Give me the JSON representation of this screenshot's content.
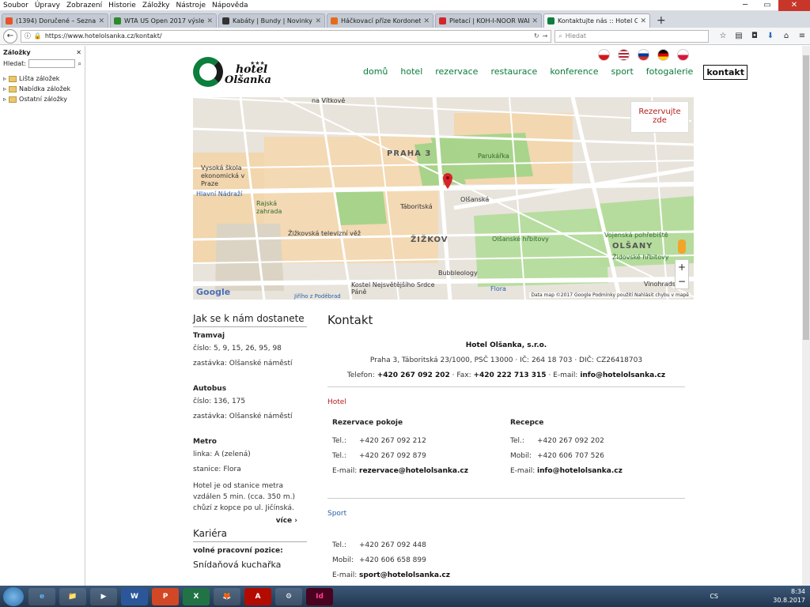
{
  "menubar": [
    "Soubor",
    "Úpravy",
    "Zobrazení",
    "Historie",
    "Záložky",
    "Nástroje",
    "Nápověda"
  ],
  "tabs": [
    {
      "label": "(1394) Doručené – Seznam E",
      "color": "#e8532b"
    },
    {
      "label": "WTA US Open 2017 výsledky",
      "color": "#2b8a2b"
    },
    {
      "label": "Kabáty | Bundy | Novinky | O",
      "color": "#333333"
    },
    {
      "label": "Háčkovací příze Kordonet 30",
      "color": "#e56c1b"
    },
    {
      "label": "Pletací | KOH-I-NOOR WALD",
      "color": "#d3262c"
    },
    {
      "label": "Kontaktujte nás :: Hotel Olšan",
      "color": "#0c7f3c",
      "active": true
    }
  ],
  "nav": {
    "url": "https://www.hotelolsanka.cz/kontakt/",
    "search_placeholder": "Hledat"
  },
  "sidebar": {
    "title": "Záložky",
    "search_label": "Hledat:",
    "items": [
      "Lišta záložek",
      "Nabídka záložek",
      "Ostatní záložky"
    ]
  },
  "logo": {
    "stars": "★★★",
    "hotel": "hotel",
    "name": "Olšanka"
  },
  "flags": [
    "#d7141a",
    "#3c3b6e",
    "#0039a6",
    "#000000",
    "#dc143c"
  ],
  "mainnav": [
    {
      "label": "domů"
    },
    {
      "label": "hotel"
    },
    {
      "label": "rezervace"
    },
    {
      "label": "restaurace"
    },
    {
      "label": "konference"
    },
    {
      "label": "sport"
    },
    {
      "label": "fotogalerie"
    },
    {
      "label": "kontakt",
      "active": true
    }
  ],
  "map": {
    "rez_line1": "Rezervujte",
    "rez_line2": "zde",
    "google": "Google",
    "footer": "Data map ©2017 Google   Podmínky použití   Nahlásit chybu v mapě",
    "labels": {
      "praha3": "PRAHA 3",
      "zizkov": "ŽIŽKOV",
      "olsany": "OLŠANY",
      "vysoka": "Vysoká škola ekonomická v Praze",
      "hlavni": "Hlavní Nádraží",
      "riegrovy": "Riegrovy sady",
      "rajska": "Rajská zahrada",
      "vez": "Žižkovská televizní věž",
      "parukarka": "Parukářka",
      "olsanske": "Olšanské hřbitovy",
      "vojenska": "Vojenská pohřebiště",
      "zidovske": "Židovské hřbitovy",
      "bubbleology": "Bubbleology",
      "kostel": "Kostel Nejsvětějšího Srdce Páně",
      "taborska": "Táboritská",
      "olsanska": "Olšanská",
      "vitkove": "na Vítkově",
      "jiriho": "Jiřího z Poděbrad",
      "flora": "Flora",
      "vinohradska": "Vinohradská"
    }
  },
  "left": {
    "title": "Jak se k nám dostanete",
    "tram": {
      "title": "Tramvaj",
      "line1": "číslo: 5, 9, 15, 26, 95, 98",
      "line2": "zastávka: Olšanské náměstí"
    },
    "bus": {
      "title": "Autobus",
      "line1": "číslo: 136, 175",
      "line2": "zastávka: Olšanské náměstí"
    },
    "metro": {
      "title": "Metro",
      "line1": "linka: A (zelená)",
      "line2": "stanice: Flora",
      "para": "Hotel je od stanice metra vzdálen 5 min. (cca. 350 m.) chůzí z kopce po ul. Jičínská."
    },
    "more": "více ›",
    "career_title": "Kariéra",
    "career_sub": "volné pracovní pozice:",
    "career_item": "Snídaňová kuchařka"
  },
  "kontakt": {
    "title": "Kontakt",
    "company": "Hotel Olšanka, s.r.o.",
    "address": "Praha 3, Táboritská 23/1000, PSČ 13000  · IČ: 264 18 703  · DIČ: CZ26418703",
    "phone_label": "Telefon:",
    "phone": "+420 267 092 202",
    "fax_label": "· Fax:",
    "fax": "+420 222 713 315",
    "email_label": "· E-mail:",
    "email": "info@hotelolsanka.cz",
    "hotel_section": "Hotel",
    "rez": {
      "title": "Rezervace pokoje",
      "tel1": "+420 267 092 212",
      "tel2": "+420 267 092 879",
      "email": "rezervace@hotelolsanka.cz"
    },
    "rec": {
      "title": "Recepce",
      "tel": "+420 267 092 202",
      "mobil": "+420 606 707 526",
      "email": "info@hotelolsanka.cz"
    },
    "sport_section": "Sport",
    "sport": {
      "tel": "+420 267 092 448",
      "mobil": "+420 606 658 899",
      "email": "sport@hotelolsanka.cz"
    },
    "k_tel": "Tel.:",
    "k_mobil": "Mobil:",
    "k_email": "E-mail:"
  },
  "taskbar": {
    "time": "8:34",
    "date": "30.8.2017",
    "lang": "CS",
    "apps": [
      "e",
      "📁",
      "▶",
      "W",
      "P",
      "X",
      "🦊",
      "A",
      "⚙",
      "Id"
    ]
  }
}
